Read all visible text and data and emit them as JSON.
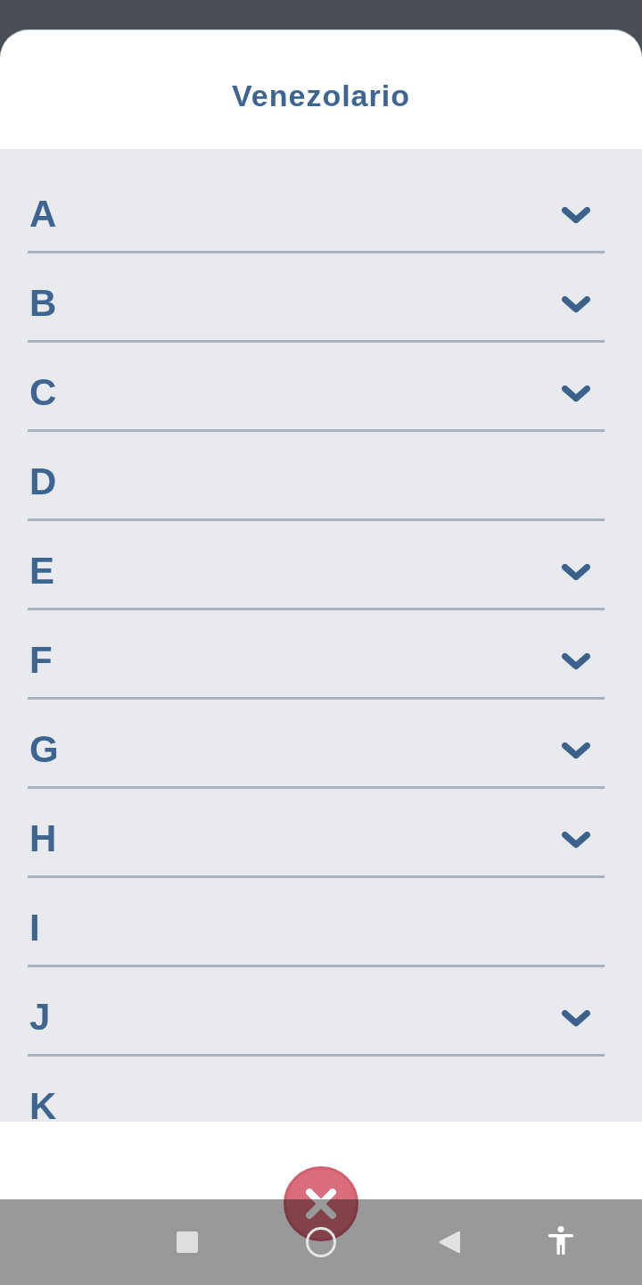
{
  "dialog": {
    "title": "Venezolario"
  },
  "sections": [
    {
      "letter": "A",
      "expandable": true
    },
    {
      "letter": "B",
      "expandable": true
    },
    {
      "letter": "C",
      "expandable": true
    },
    {
      "letter": "D",
      "expandable": false
    },
    {
      "letter": "E",
      "expandable": true
    },
    {
      "letter": "F",
      "expandable": true
    },
    {
      "letter": "G",
      "expandable": true
    },
    {
      "letter": "H",
      "expandable": true
    },
    {
      "letter": "I",
      "expandable": false
    },
    {
      "letter": "J",
      "expandable": true
    },
    {
      "letter": "K",
      "expandable": false
    }
  ]
}
